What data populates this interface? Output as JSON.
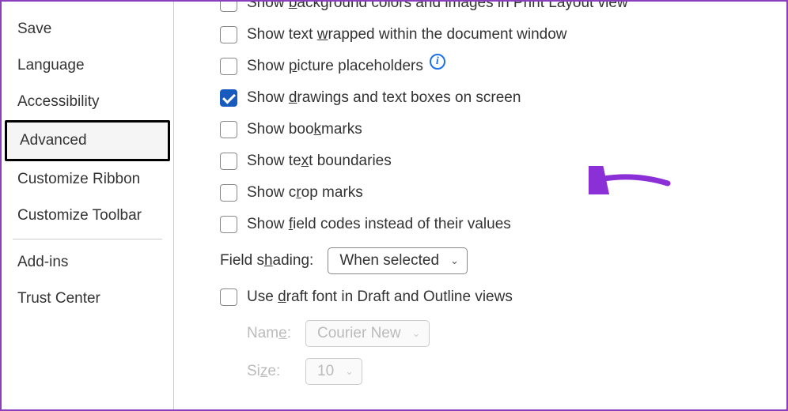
{
  "sidebar": {
    "items": [
      {
        "label": "Save"
      },
      {
        "label": "Language"
      },
      {
        "label": "Accessibility"
      },
      {
        "label": "Advanced",
        "selected": true
      },
      {
        "label": "Customize Ribbon"
      },
      {
        "label": "Customize Toolbar"
      }
    ],
    "items2": [
      {
        "label": "Add-ins"
      },
      {
        "label": "Trust Center"
      }
    ]
  },
  "options": {
    "partial_top_pre": "Show ",
    "partial_top_u": "b",
    "partial_top_post": "ackground colors and images in Print Layout view",
    "wrapped_pre": "Show text ",
    "wrapped_u": "w",
    "wrapped_post": "rapped within the document window",
    "picture_pre": "Show ",
    "picture_u": "p",
    "picture_post": "icture placeholders",
    "drawings_pre": "Show ",
    "drawings_u": "d",
    "drawings_post": "rawings and text boxes on screen",
    "bookmarks_pre": "Show boo",
    "bookmarks_u": "k",
    "bookmarks_post": "marks",
    "textb_pre": "Show te",
    "textb_u": "x",
    "textb_post": "t boundaries",
    "crop_pre": "Show c",
    "crop_u": "r",
    "crop_post": "op marks",
    "field_pre": "Show ",
    "field_u": "f",
    "field_post": "ield codes instead of their values",
    "shading_pre": "Field s",
    "shading_u": "h",
    "shading_post": "ading:",
    "shading_value": "When selected",
    "draft_pre": "Use ",
    "draft_u": "d",
    "draft_post": "raft font in Draft and Outline views",
    "name_pre": "Nam",
    "name_u": "e",
    "name_post": ":",
    "name_value": "Courier New",
    "size_pre": "Si",
    "size_u": "z",
    "size_post": "e:",
    "size_value": "10"
  }
}
